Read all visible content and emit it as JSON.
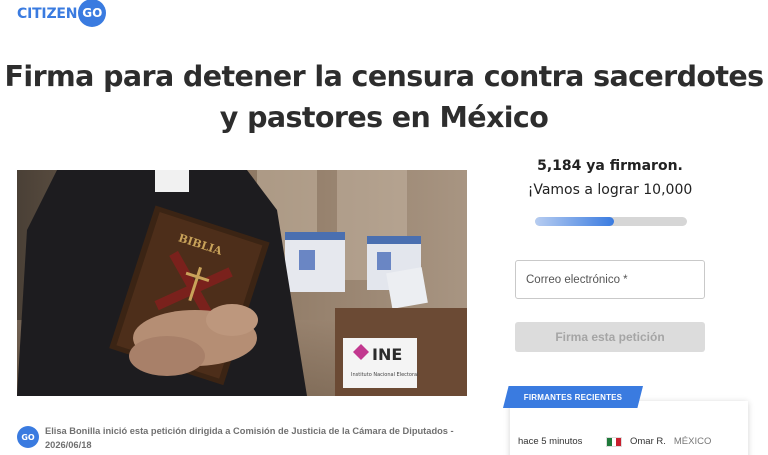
{
  "logo": {
    "text": "CITIZEN",
    "circle_text": "GO"
  },
  "petition": {
    "title_line1": "Firma para detener la censura contra sacerdotes",
    "title_line2": "y pastores en México"
  },
  "hero_image": {
    "description_labels": {
      "bible": "BIBLIA",
      "ine_logo": "INE",
      "ine_subtitle": "Instituto Nacional Electoral"
    }
  },
  "signatures": {
    "count_label": "5,184 ya firmaron.",
    "goal_label": "¡Vamos a lograr 10,000",
    "progress_fraction": 0.5184
  },
  "form": {
    "email_placeholder": "Correo electrónico *",
    "sign_button": "Firma esta petición"
  },
  "recent_signers": {
    "tab_label": "FIRMANTES RECIENTES",
    "items": [
      {
        "time": "hace 5 minutos",
        "flag": "mexico-flag",
        "name": "Omar R.",
        "country": "MÉXICO"
      }
    ]
  },
  "author": {
    "avatar_text": "GO",
    "line1": "Elisa Bonilla inició esta petición dirigida a Comisión de Justicia de la Cámara de Diputados -",
    "line2": "2026/06/18"
  },
  "colors": {
    "brand_blue": "#3a7be0",
    "button_disabled": "#dcdcdc"
  }
}
